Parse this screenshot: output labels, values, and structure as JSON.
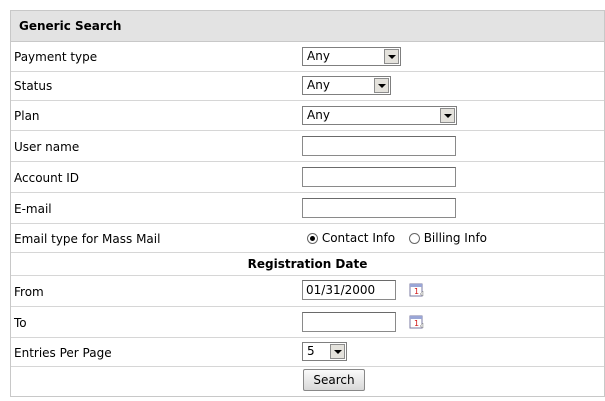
{
  "title": "Generic Search",
  "fields": {
    "payment_type": {
      "label": "Payment type",
      "value": "Any"
    },
    "status": {
      "label": "Status",
      "value": "Any"
    },
    "plan": {
      "label": "Plan",
      "value": "Any"
    },
    "user_name": {
      "label": "User name",
      "value": ""
    },
    "account_id": {
      "label": "Account ID",
      "value": ""
    },
    "email": {
      "label": "E-mail",
      "value": ""
    },
    "email_type": {
      "label": "Email type for Mass Mail",
      "options": [
        "Contact Info",
        "Billing Info"
      ],
      "selected": "Contact Info"
    },
    "registration_date": {
      "heading": "Registration Date"
    },
    "from": {
      "label": "From",
      "value": "01/31/2000"
    },
    "to": {
      "label": "To",
      "value": ""
    },
    "entries_per_page": {
      "label": "Entries Per Page",
      "value": "5"
    }
  },
  "search_button": "Search",
  "icons": {
    "calendar": "calendar-icon"
  }
}
